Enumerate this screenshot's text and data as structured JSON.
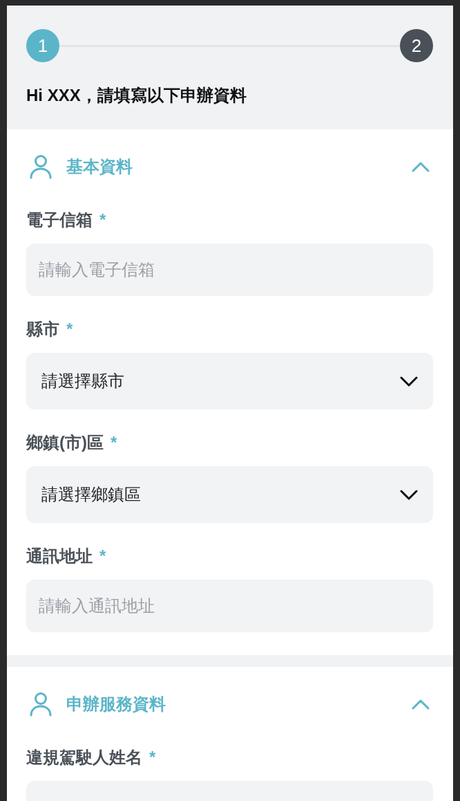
{
  "stepper": {
    "steps": [
      {
        "number": "1",
        "current": true
      },
      {
        "number": "2",
        "current": false
      }
    ]
  },
  "greeting": "Hi XXX，請填寫以下申辦資料",
  "sections": [
    {
      "title": "基本資料",
      "expanded": true,
      "fields": [
        {
          "kind": "text",
          "label": "電子信箱",
          "mark": "*",
          "placeholder": "請輸入電子信箱"
        },
        {
          "kind": "select",
          "label": "縣市",
          "mark": "*",
          "value": "請選擇縣市"
        },
        {
          "kind": "select",
          "label": "鄉鎮(市)區",
          "mark": "*",
          "value": "請選擇鄉鎮區"
        },
        {
          "kind": "text",
          "label": "通訊地址",
          "mark": "*",
          "placeholder": "請輸入通訊地址"
        }
      ]
    },
    {
      "title": "申辦服務資料",
      "expanded": true,
      "fields": [
        {
          "kind": "text",
          "label": "違規駕駛人姓名",
          "mark": "*"
        }
      ]
    }
  ]
}
